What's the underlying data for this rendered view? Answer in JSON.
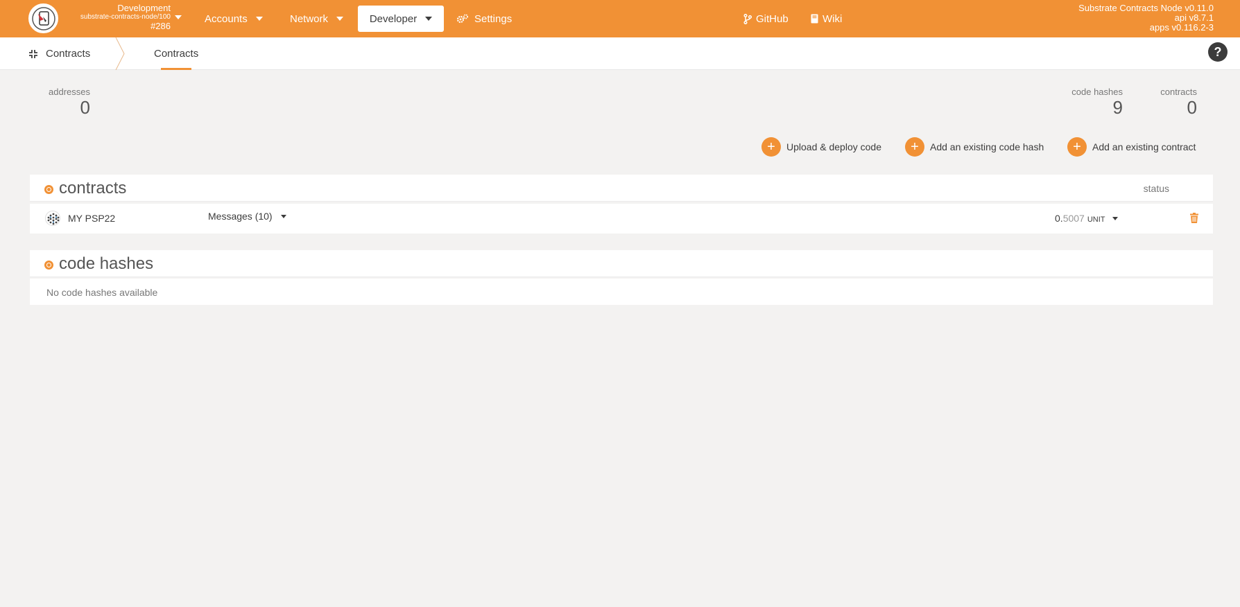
{
  "chain": {
    "name": "Development",
    "node": "substrate-contracts-node/100",
    "block": "#286"
  },
  "nav": {
    "accounts": "Accounts",
    "network": "Network",
    "developer": "Developer",
    "settings": "Settings",
    "github": "GitHub",
    "wiki": "Wiki"
  },
  "versions": {
    "node": "Substrate Contracts Node v0.11.0",
    "api": "api v8.7.1",
    "apps": "apps v0.116.2-3"
  },
  "subnav": {
    "section": "Contracts",
    "tab": "Contracts"
  },
  "summary": {
    "addresses_label": "addresses",
    "addresses_value": "0",
    "codehashes_label": "code hashes",
    "codehashes_value": "9",
    "contracts_label": "contracts",
    "contracts_value": "0"
  },
  "actions": {
    "upload": "Upload & deploy code",
    "add_codehash": "Add an existing code hash",
    "add_contract": "Add an existing contract"
  },
  "contracts_table": {
    "title": "contracts",
    "status_header": "status",
    "rows": [
      {
        "name": "MY PSP22",
        "messages": "Messages (10)",
        "balance_int": "0.",
        "balance_dec": "5007",
        "unit": "UNIT"
      }
    ]
  },
  "codehashes_table": {
    "title": "code hashes",
    "empty": "No code hashes available"
  },
  "colors": {
    "brand": "#f19135",
    "background": "#f3f2f1",
    "text": "#3c3c3c"
  }
}
